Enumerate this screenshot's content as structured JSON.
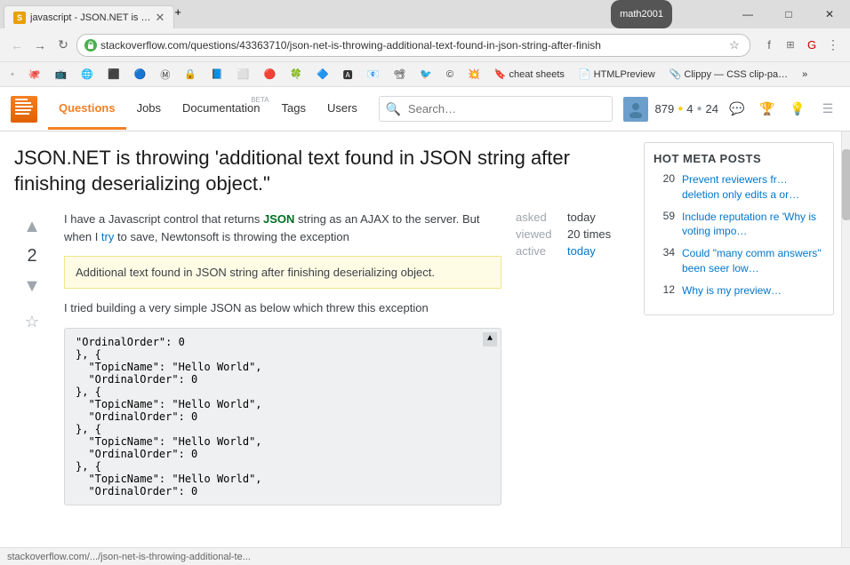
{
  "window": {
    "pill_text": "math2001",
    "minimize": "—",
    "maximize": "□",
    "close": "✕"
  },
  "tab": {
    "title": "javascript - JSON.NET is …",
    "favicon_char": "S"
  },
  "navbar": {
    "url": "stackoverflow.com/questions/43363710/json-net-is-throwing-additional-text-found-in-json-string-after-finish"
  },
  "bookmarks": [
    {
      "label": "",
      "icon": "🔖"
    },
    {
      "label": "",
      "icon": "🐙"
    },
    {
      "label": "",
      "icon": "📺"
    },
    {
      "label": "",
      "icon": "🌐"
    },
    {
      "label": "",
      "icon": "⬛"
    },
    {
      "label": "",
      "icon": "🔵"
    },
    {
      "label": "",
      "icon": "Ⓜ"
    },
    {
      "label": "",
      "icon": "🔒"
    },
    {
      "label": "",
      "icon": "📘"
    },
    {
      "label": "",
      "icon": "⬜"
    },
    {
      "label": "",
      "icon": "🔴"
    },
    {
      "label": "",
      "icon": "🍀"
    },
    {
      "label": "",
      "icon": "🔷"
    },
    {
      "label": "",
      "icon": "🅰"
    },
    {
      "label": "",
      "icon": "📧"
    },
    {
      "label": "",
      "icon": "📽"
    },
    {
      "label": "",
      "icon": "🐦"
    },
    {
      "label": "",
      "icon": "©"
    },
    {
      "label": "",
      "icon": "💥"
    },
    {
      "label": "cheat sheets",
      "icon": "🔖"
    },
    {
      "label": "HTMLPreview",
      "icon": "📄"
    },
    {
      "label": "Clippy — CSS clip-pa…",
      "icon": "📎"
    }
  ],
  "so_header": {
    "logo_char": "S",
    "nav_items": [
      {
        "label": "Questions",
        "active": true
      },
      {
        "label": "Jobs",
        "active": false
      },
      {
        "label": "Documentation",
        "active": false,
        "beta": true
      },
      {
        "label": "Tags",
        "active": false
      },
      {
        "label": "Users",
        "active": false
      }
    ],
    "search_placeholder": "Search…",
    "user_rep": "879",
    "user_gold": "4",
    "user_silver": "24"
  },
  "question": {
    "title": "JSON.NET is throwing 'additional text found in JSON string after finishing deserializing object.\"",
    "vote_count": "2",
    "body_p1_start": "I have a Javascript control that returns ",
    "body_p1_json": "JSON",
    "body_p1_mid": " string as an AJAX to the server. But when I ",
    "body_p1_link": "try",
    "body_p1_end": " to save, Newtonsoft is throwing the exception",
    "error_text": "Additional text found in JSON string after finishing deserializing object.",
    "body_p2": "I tried building a very simple JSON as below which threw this exception",
    "code": "\"OrdinalOrder\": 0\n}, {\n  \"TopicName\": \"Hello World\",\n  \"OrdinalOrder\": 0\n}, {\n  \"TopicName\": \"Hello World\",\n  \"OrdinalOrder\": 0\n}, {\n  \"TopicName\": \"Hello World\",\n  \"OrdinalOrder\": 0\n}, {\n  \"TopicName\": \"Hello World\",\n  \"OrdinalOrder\": 0"
  },
  "meta_sidebar": {
    "asked_label": "asked",
    "asked_value": "today",
    "viewed_label": "viewed",
    "viewed_value": "20 times",
    "active_label": "active",
    "active_value": "today"
  },
  "hot_meta": {
    "title": "HOT META POSTS",
    "items": [
      {
        "count": "20",
        "text": "Prevent reviewers fr… deletion only edits a or…"
      },
      {
        "count": "59",
        "text": "Include reputation re 'Why is voting impo…"
      },
      {
        "count": "34",
        "text": "Could \"many comm answers\" been seer low…"
      },
      {
        "count": "12",
        "text": "Why is my preview…"
      }
    ]
  },
  "status_bar": {
    "text": "stackoverflow.com/.../json-net-is-throwing-additional-te..."
  }
}
